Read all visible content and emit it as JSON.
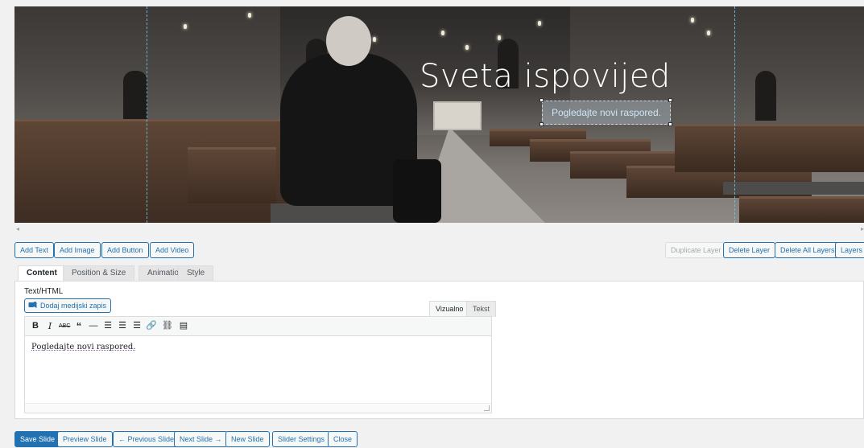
{
  "slide_preview": {
    "title": "Sveta ispovijed",
    "link_text": "Pogledajte novi raspored."
  },
  "layer_toolbar": {
    "add_text": "Add Text",
    "add_image": "Add Image",
    "add_button": "Add Button",
    "add_video": "Add Video",
    "duplicate_layer": "Duplicate Layer",
    "delete_layer": "Delete Layer",
    "delete_all_layers": "Delete All Layers",
    "layers": "Layers"
  },
  "tabs": [
    {
      "label": "Content",
      "active": true
    },
    {
      "label": "Position & Size",
      "active": false
    },
    {
      "label": "Animation",
      "active": false
    },
    {
      "label": "Style",
      "active": false
    }
  ],
  "content_panel": {
    "field_label": "Text/HTML",
    "media_button": "Dodaj medijski zapis",
    "editor_tabs": [
      {
        "label": "Vizualno",
        "active": true
      },
      {
        "label": "Tekst",
        "active": false
      }
    ],
    "toolbar_icons": [
      "bold-icon",
      "italic-icon",
      "strikethrough-icon",
      "blockquote-icon",
      "horizontal-line-icon",
      "align-left-icon",
      "align-center-icon",
      "align-right-icon",
      "link-icon",
      "unlink-icon",
      "toolbar-toggle-icon"
    ],
    "editor_content": "Pogledajte novi raspored."
  },
  "footer_buttons": {
    "save_slide": "Save Slide",
    "preview_slide": "Preview Slide",
    "previous_slide": "← Previous Slide",
    "next_slide": "Next Slide →",
    "new_slide": "New Slide",
    "slider_settings": "Slider Settings",
    "close": "Close"
  },
  "colors": {
    "accent": "#2271b1",
    "background": "#f1f1f1",
    "guide_line": "#6fc6e6"
  }
}
